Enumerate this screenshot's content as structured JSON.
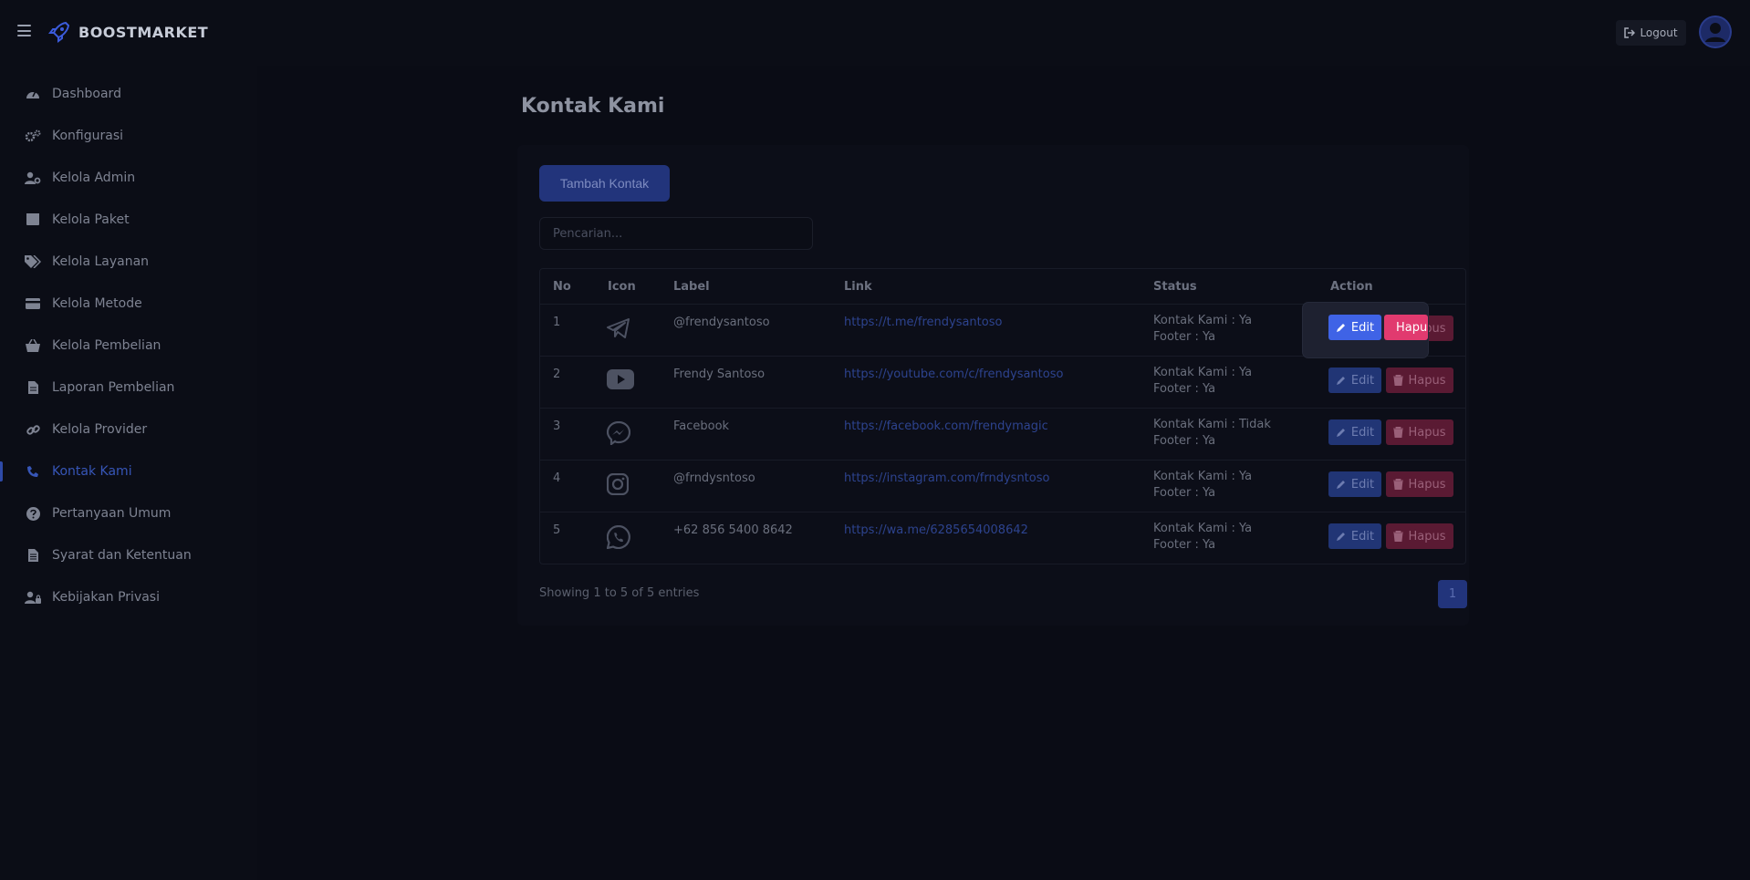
{
  "brand": {
    "name": "BOOSTMARKET"
  },
  "header": {
    "logout_label": "Logout"
  },
  "sidebar": {
    "items": [
      {
        "label": "Dashboard",
        "icon": "dashboard-icon"
      },
      {
        "label": "Konfigurasi",
        "icon": "cogs-icon"
      },
      {
        "label": "Kelola Admin",
        "icon": "user-cog-icon"
      },
      {
        "label": "Kelola Paket",
        "icon": "box-icon"
      },
      {
        "label": "Kelola Layanan",
        "icon": "tags-icon"
      },
      {
        "label": "Kelola Metode",
        "icon": "credit-card-icon"
      },
      {
        "label": "Kelola Pembelian",
        "icon": "basket-icon"
      },
      {
        "label": "Laporan Pembelian",
        "icon": "file-icon"
      },
      {
        "label": "Kelola Provider",
        "icon": "link-icon"
      },
      {
        "label": "Kontak Kami",
        "icon": "phone-icon",
        "active": true
      },
      {
        "label": "Pertanyaan Umum",
        "icon": "question-circle-icon"
      },
      {
        "label": "Syarat dan Ketentuan",
        "icon": "file-alt-icon"
      },
      {
        "label": "Kebijakan Privasi",
        "icon": "user-lock-icon"
      }
    ]
  },
  "page": {
    "title": "Kontak Kami",
    "add_button": "Tambah Kontak",
    "search_placeholder": "Pencarian..."
  },
  "table": {
    "headers": {
      "no": "No",
      "icon": "Icon",
      "label": "Label",
      "link": "Link",
      "status": "Status",
      "action": "Action"
    },
    "rows": [
      {
        "no": "1",
        "icon": "telegram-icon",
        "label": "@frendysantoso",
        "link": "https://t.me/frendysantoso",
        "status1": "Kontak Kami : Ya",
        "status2": "Footer : Ya"
      },
      {
        "no": "2",
        "icon": "youtube-icon",
        "label": "Frendy Santoso",
        "link": "https://youtube.com/c/frendysantoso",
        "status1": "Kontak Kami : Ya",
        "status2": "Footer : Ya"
      },
      {
        "no": "3",
        "icon": "messenger-icon",
        "label": "Facebook",
        "link": "https://facebook.com/frendymagic",
        "status1": "Kontak Kami : Tidak",
        "status2": "Footer : Ya"
      },
      {
        "no": "4",
        "icon": "instagram-icon",
        "label": "@frndysntoso",
        "link": "https://instagram.com/frndysntoso",
        "status1": "Kontak Kami : Ya",
        "status2": "Footer : Ya"
      },
      {
        "no": "5",
        "icon": "whatsapp-icon",
        "label": "+62 856 5400 8642",
        "link": "https://wa.me/6285654008642",
        "status1": "Kontak Kami : Ya",
        "status2": "Footer : Ya"
      }
    ],
    "edit_label": "Edit",
    "delete_label": "Hapus"
  },
  "footer": {
    "showing": "Showing 1 to 5 of 5 entries",
    "current_page": "1"
  },
  "colors": {
    "accent": "#3f63e6",
    "danger": "#e13a6f",
    "background": "#0b0d16"
  }
}
